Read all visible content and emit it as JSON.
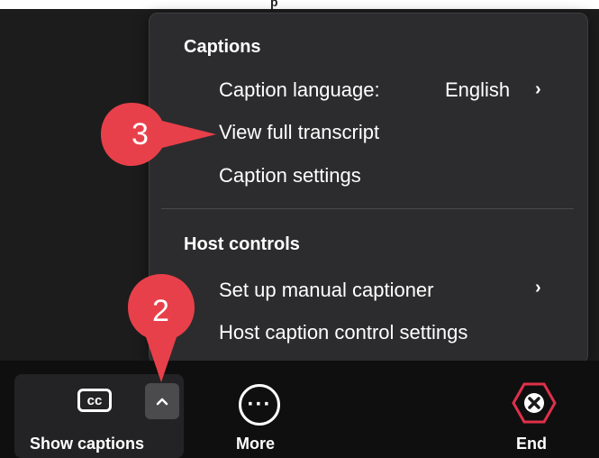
{
  "top_fragment": "p",
  "menu": {
    "captions_heading": "Captions",
    "caption_language_label": "Caption language:",
    "caption_language_value": "English",
    "view_transcript_label": "View full transcript",
    "caption_settings_label": "Caption settings",
    "host_controls_heading": "Host controls",
    "manual_captioner_label": "Set up manual captioner",
    "host_caption_settings_label": "Host caption control settings"
  },
  "toolbar": {
    "cc_icon_text": "cc",
    "show_captions_label": "Show captions",
    "more_label": "More",
    "end_label": "End"
  },
  "callouts": {
    "step_2": "2",
    "step_3": "3"
  },
  "colors": {
    "menu_bg": "#2c2c2e",
    "toolbar_bg": "#0f0f0f",
    "callout_red": "#e8404a",
    "end_red": "#e0304a"
  }
}
